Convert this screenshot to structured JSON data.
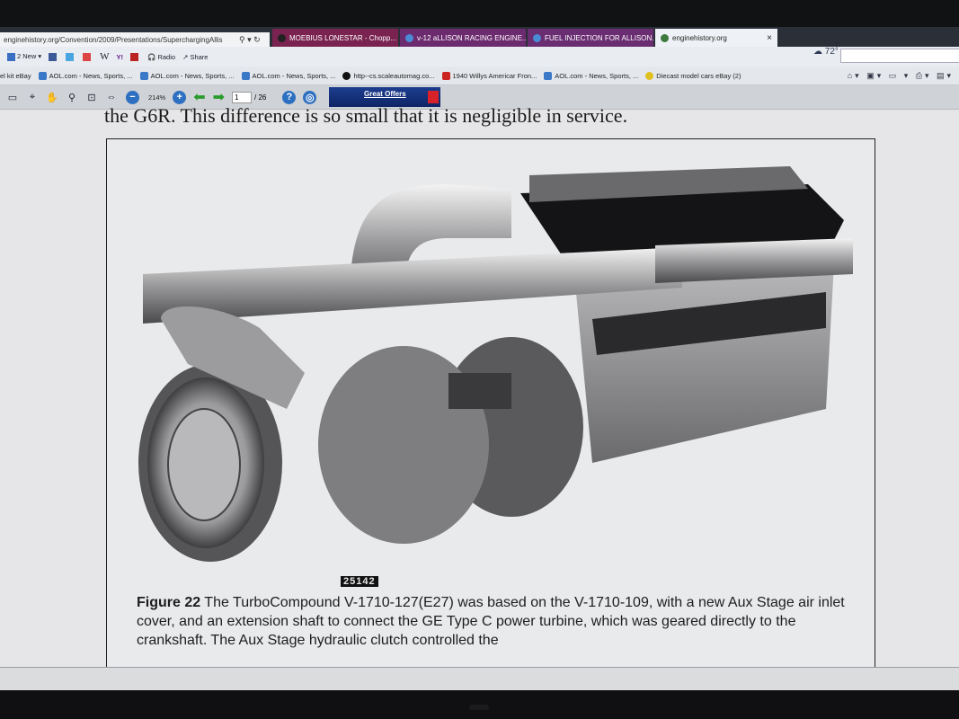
{
  "browser": {
    "address": "enginehistory.org/Convention/2009/Presentations/SuperchargingAllis",
    "tabs": [
      {
        "label": "MOEBIUS LONESTAR - Chopp..."
      },
      {
        "label": "v-12 aLLISON RACING ENGINE..."
      },
      {
        "label": "FUEL INJECTION FOR ALLISON..."
      },
      {
        "label": "enginehistory.org",
        "close": "×"
      }
    ],
    "weather": "72°"
  },
  "toolbar": {
    "new_label": "2 New",
    "radio_label": "Radio",
    "share_label": "Share"
  },
  "favorites": [
    {
      "label": "el kit  eBay"
    },
    {
      "label": "AOL.com - News, Sports, ..."
    },
    {
      "label": "AOL.com - News, Sports, ..."
    },
    {
      "label": "AOL.com - News, Sports, ..."
    },
    {
      "label": "http--cs.scaleautomag.co..."
    },
    {
      "label": "1940 Willys Americar Fron..."
    },
    {
      "label": "AOL.com - News, Sports, ..."
    },
    {
      "label": "Diecast model cars  eBay (2)"
    }
  ],
  "pdf": {
    "zoom": "214%",
    "page": "1",
    "total": "/ 26",
    "offers": "Great Offers"
  },
  "document": {
    "cut_text": "the G6R.  This difference is so small that it is negligible in service.",
    "tag": "25142",
    "caption_label": "Figure 22",
    "caption_text": " The TurboCompound V-1710-127(E27) was based on the V-1710-109, with a new Aux Stage air inlet cover, and an extension shaft to connect the GE Type C power turbine, which was geared directly to the crankshaft.  The Aux Stage hydraulic clutch controlled the"
  }
}
